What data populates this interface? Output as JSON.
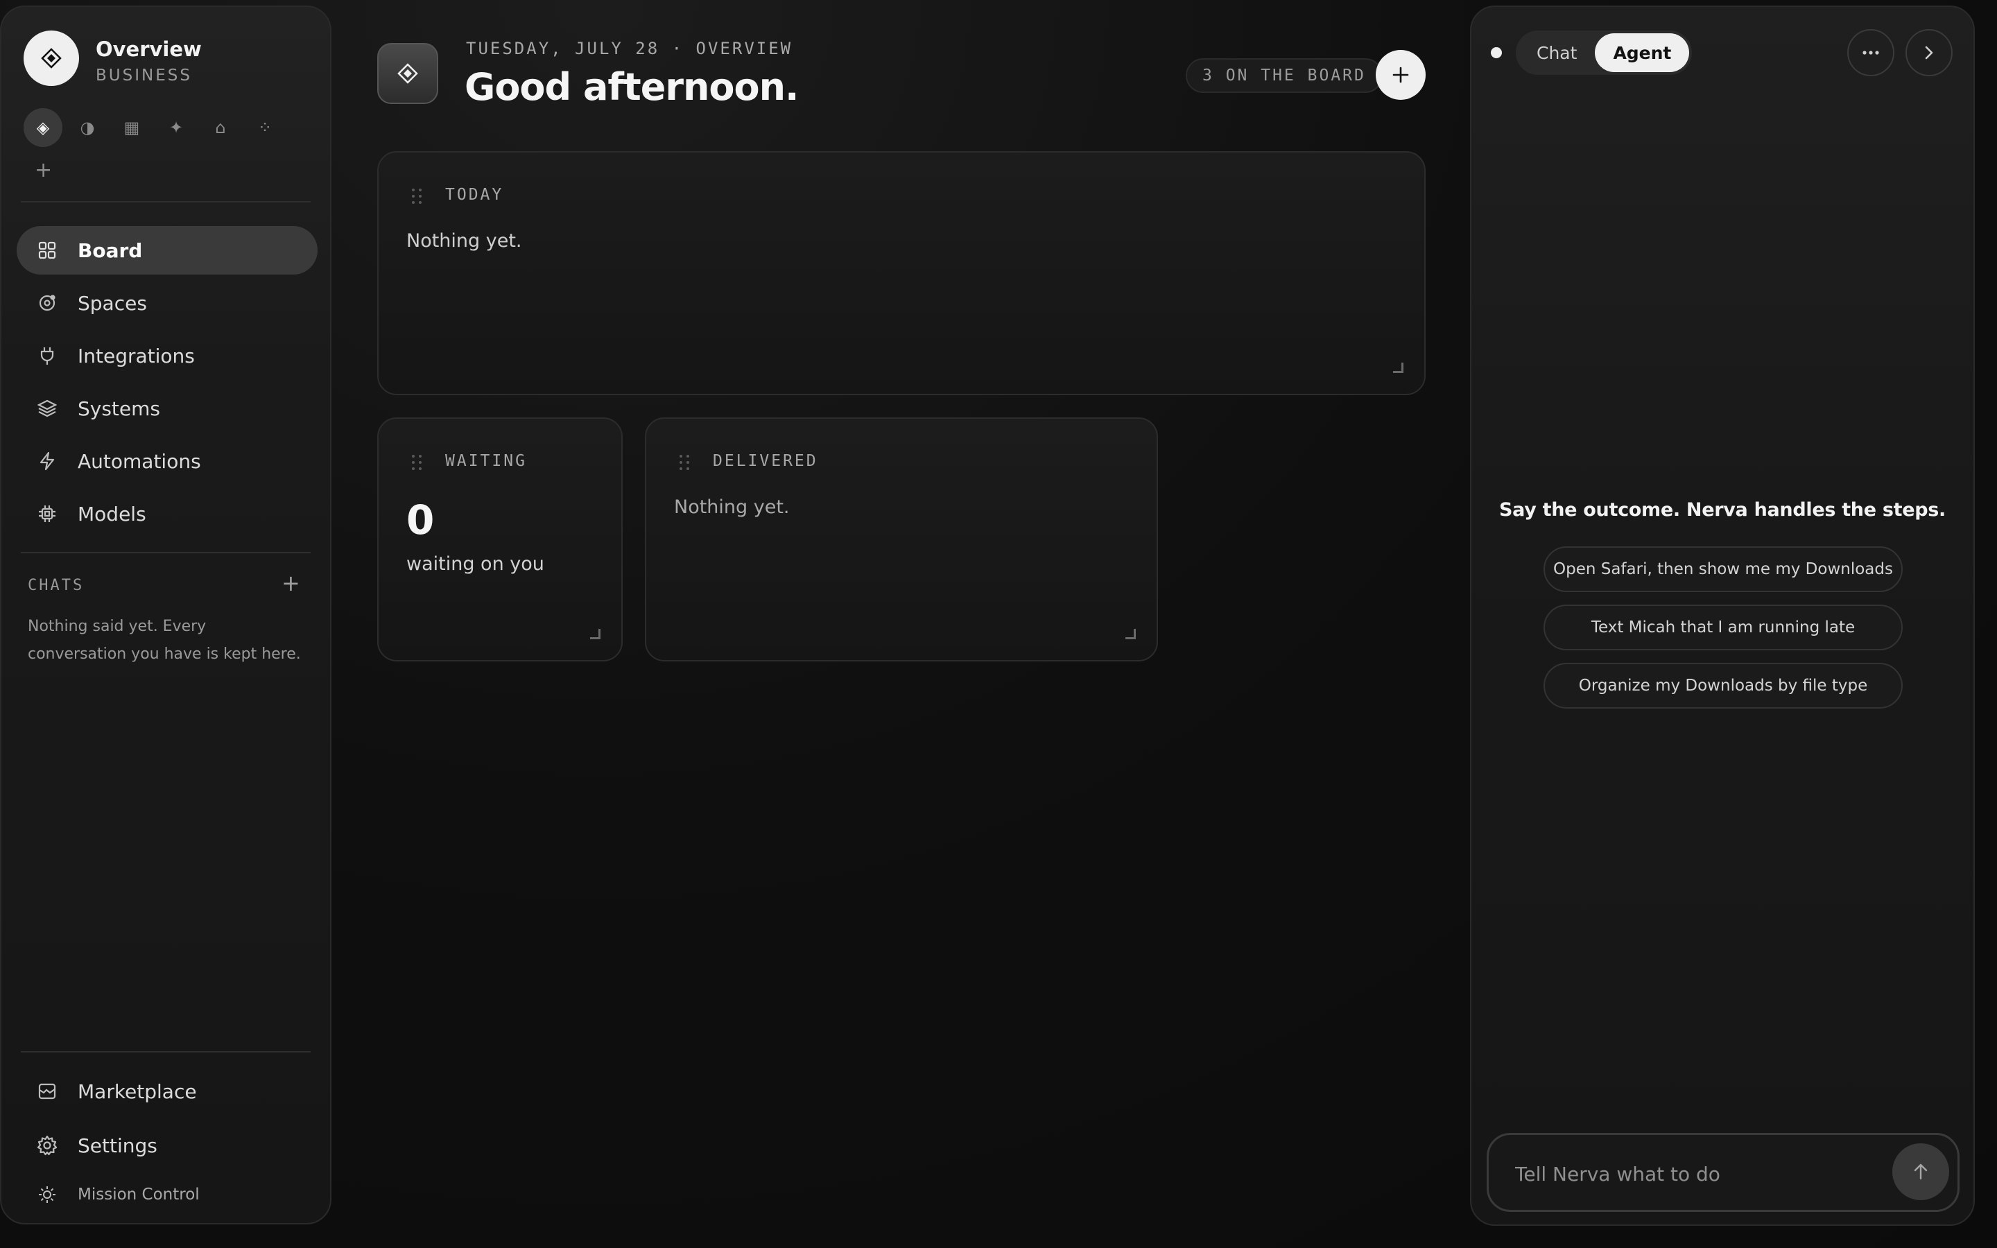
{
  "sidebar": {
    "workspace_title": "Overview",
    "workspace_subtitle": "BUSINESS",
    "workspace_icons": [
      "diamond-icon",
      "half-circle-icon",
      "square-icon",
      "sparkle-icon",
      "home-icon",
      "dots-diamond-icon"
    ],
    "nav_items": [
      {
        "label": "Board",
        "icon": "grid-icon",
        "active": true
      },
      {
        "label": "Spaces",
        "icon": "spaces-icon",
        "active": false
      },
      {
        "label": "Integrations",
        "icon": "plug-icon",
        "active": false
      },
      {
        "label": "Systems",
        "icon": "layers-icon",
        "active": false
      },
      {
        "label": "Automations",
        "icon": "bolt-icon",
        "active": false
      },
      {
        "label": "Models",
        "icon": "chip-icon",
        "active": false
      }
    ],
    "chats_heading": "CHATS",
    "chats_empty": "Nothing said yet. Every conversation you have is kept here.",
    "bottom_items": [
      {
        "label": "Marketplace",
        "icon": "marketplace-icon"
      },
      {
        "label": "Settings",
        "icon": "gear-icon"
      }
    ],
    "mission_control": "Mission Control"
  },
  "main": {
    "date_line": "TUESDAY, JULY 28 · OVERVIEW",
    "greeting": "Good afternoon.",
    "board_count": "3 ON THE BOARD",
    "cards": {
      "today": {
        "title": "TODAY",
        "body": "Nothing yet."
      },
      "waiting": {
        "title": "WAITING",
        "count": "0",
        "sub": "waiting on you"
      },
      "delivered": {
        "title": "DELIVERED",
        "body": "Nothing yet."
      }
    }
  },
  "agent": {
    "tabs": [
      "Chat",
      "Agent"
    ],
    "active_tab": "Agent",
    "headline": "Say the outcome. Nerva handles the steps.",
    "suggestions": [
      "Open Safari, then show me my Downloads",
      "Text Micah that I am running late",
      "Organize my Downloads by file type"
    ],
    "input_placeholder": "Tell Nerva what to do"
  }
}
